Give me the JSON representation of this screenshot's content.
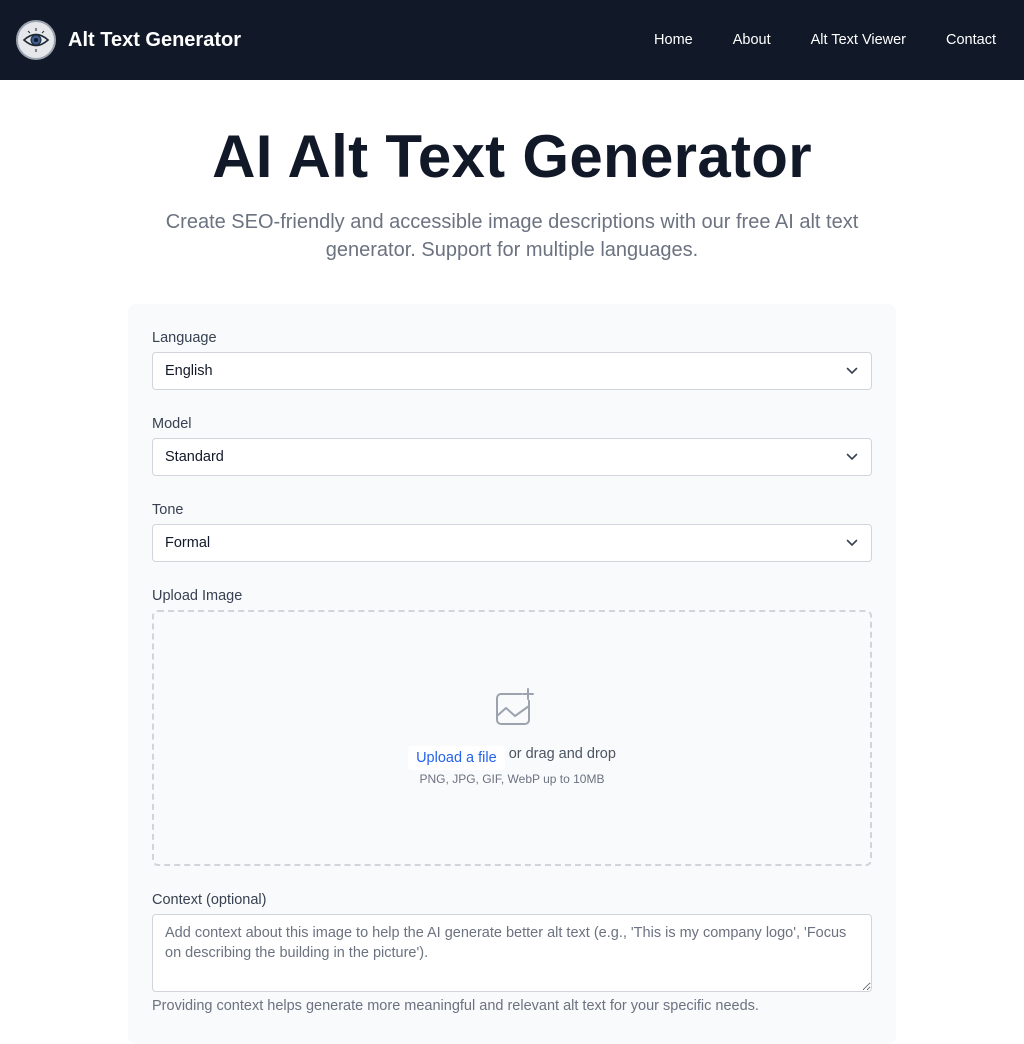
{
  "header": {
    "brand": "Alt Text Generator",
    "logo_icon": "eye-logo-icon",
    "background": "#111827",
    "nav": [
      {
        "label": "Home"
      },
      {
        "label": "About"
      },
      {
        "label": "Alt Text Viewer"
      },
      {
        "label": "Contact"
      }
    ]
  },
  "hero": {
    "title": "AI Alt Text Generator",
    "subtitle": "Create SEO-friendly and accessible image descriptions with our free AI alt text generator. Support for multiple languages."
  },
  "form": {
    "language": {
      "label": "Language",
      "value": "English"
    },
    "model": {
      "label": "Model",
      "value": "Standard"
    },
    "tone": {
      "label": "Tone",
      "value": "Formal"
    },
    "upload": {
      "label": "Upload Image",
      "icon": "image-add-icon",
      "link": "Upload a file",
      "or_text": "or drag and drop",
      "hint": "PNG, JPG, GIF, WebP up to 10MB"
    },
    "context": {
      "label": "Context (optional)",
      "placeholder": "Add context about this image to help the AI generate better alt text (e.g., 'This is my company logo', 'Focus on describing the building in the picture').",
      "helper": "Providing context helps generate more meaningful and relevant alt text for your specific needs."
    }
  },
  "colors": {
    "accent_link": "#2563eb",
    "card_bg": "#f9fafb",
    "muted_text": "#6b7280"
  }
}
